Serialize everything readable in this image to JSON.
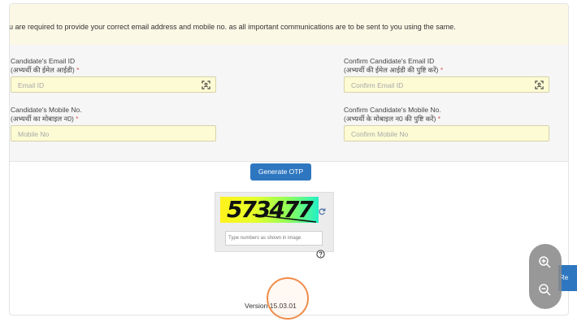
{
  "notice": {
    "text": "ou are required to provide your correct email address and mobile no. as all important communications are to be sent to you using the same."
  },
  "form": {
    "email": {
      "label_en": "Candidate's Email ID",
      "label_hi": "(अभ्यर्थी की ईमेल आईडी)",
      "required_mark": "*",
      "placeholder": "Email ID",
      "icon": "scan-icon"
    },
    "confirm_email": {
      "label_en": "Confirm Candidate's Email ID",
      "label_hi": "(अभ्यर्थी की ईमेल आईडी की पुष्टि करें)",
      "required_mark": "*",
      "placeholder": "Confirm Email ID",
      "icon": "scan-icon"
    },
    "mobile": {
      "label_en": "Candidate's Mobile No.",
      "label_hi": "(अभ्यर्थी का मोबाइल न0)",
      "required_mark": "*",
      "placeholder": "Mobile No"
    },
    "confirm_mobile": {
      "label_en": "Confirm Candidate's Mobile No.",
      "label_hi": "(अभ्यर्थी के मोबाइल न0 की पुष्टि करें)",
      "required_mark": "*",
      "placeholder": "Confirm Mobile No"
    }
  },
  "otp_button": "Generate OTP",
  "captcha": {
    "value": "573477",
    "input_placeholder": "Type numbers as shown in image",
    "refresh_icon": "refresh-icon",
    "help_icon": "help-icon"
  },
  "version": "Version 15.03.01",
  "side_tab_label": "Re",
  "zoom": {
    "in_icon": "zoom-in-icon",
    "out_icon": "zoom-out-icon"
  },
  "colors": {
    "notice_bg": "#fcf8e6",
    "input_bg": "#fdfbd4",
    "button_blue": "#2e77c0",
    "required_red": "#d9534f",
    "highlight_ring": "#f08c4a"
  }
}
